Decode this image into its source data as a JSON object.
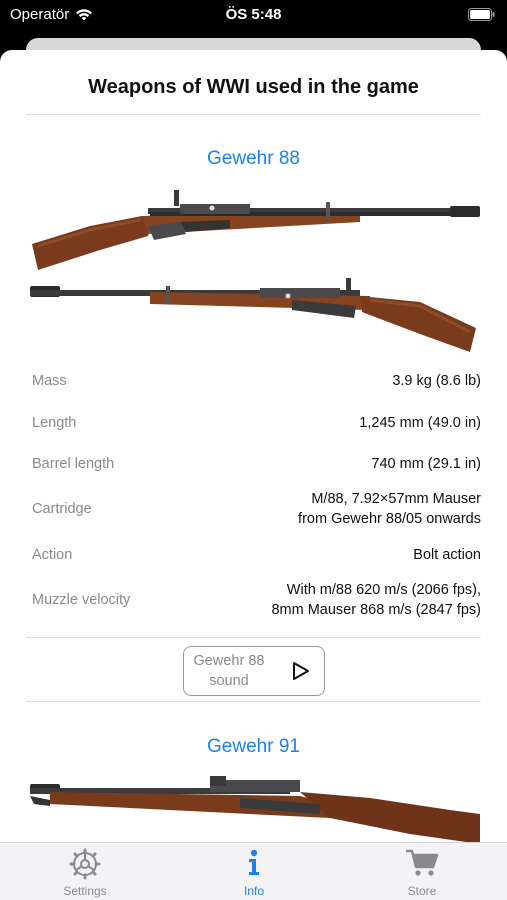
{
  "status_bar": {
    "carrier": "Operatör",
    "time": "ÖS 5:48"
  },
  "sheet": {
    "title": "Weapons of WWI used in the game"
  },
  "weapons": [
    {
      "name": "Gewehr 88",
      "specs": [
        {
          "label": "Mass",
          "value": "3.9 kg (8.6 lb)"
        },
        {
          "label": "Length",
          "value": "1,245 mm (49.0 in)"
        },
        {
          "label": "Barrel length",
          "value": "740 mm (29.1 in)"
        },
        {
          "label": "Cartridge",
          "value": "M/88, 7.92×57mm Mauser\nfrom Gewehr 88/05 onwards"
        },
        {
          "label": "Action",
          "value": "Bolt action"
        },
        {
          "label": "Muzzle velocity",
          "value": "With m/88 620 m/s (2066 fps),\n8mm Mauser 868 m/s (2847 fps)"
        }
      ],
      "sound_button": "Gewehr 88\nsound"
    },
    {
      "name": "Gewehr 91"
    }
  ],
  "tabs": [
    {
      "label": "Settings",
      "icon": "gear-icon"
    },
    {
      "label": "Info",
      "icon": "info-icon",
      "active": true
    },
    {
      "label": "Store",
      "icon": "cart-icon"
    }
  ],
  "colors": {
    "accent": "#1a82f0",
    "secondary_text": "#8a8a8e",
    "wood": "#7a3a1c",
    "metal": "#3a3a3c"
  }
}
